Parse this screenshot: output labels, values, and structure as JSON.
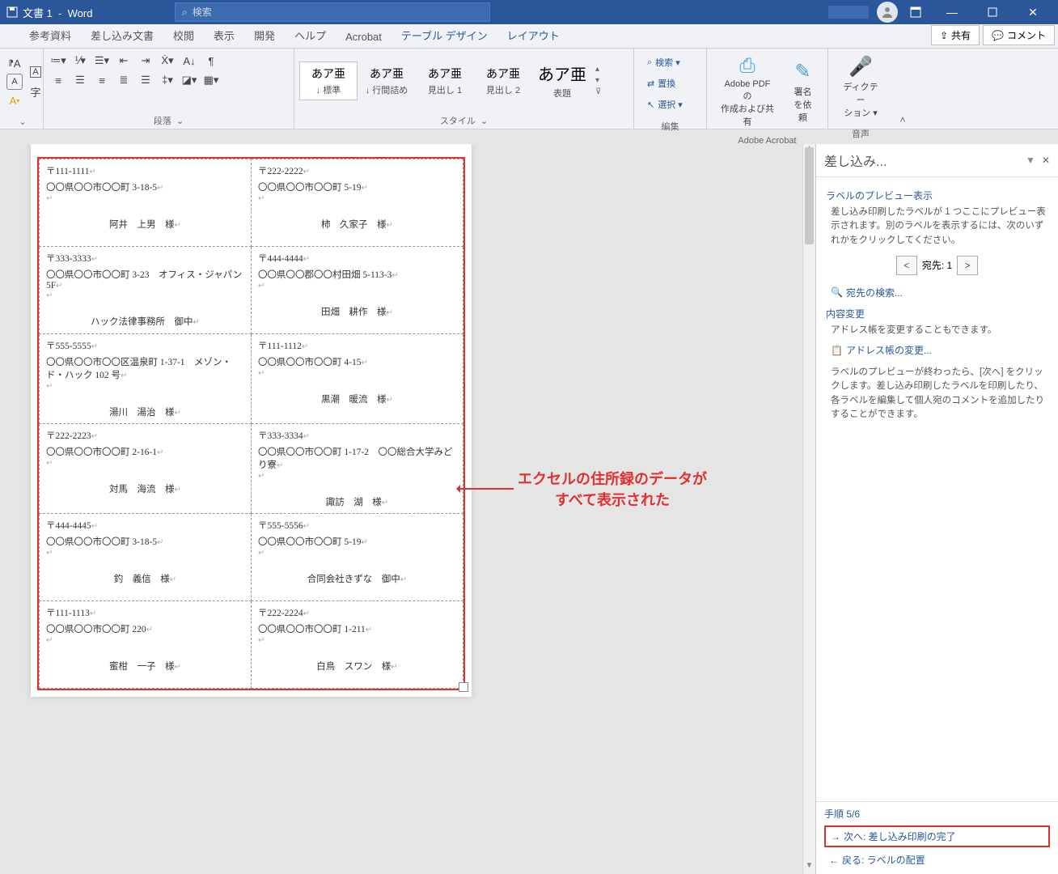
{
  "titlebar": {
    "document": "文書 1",
    "app": "Word",
    "search_placeholder": "検索"
  },
  "tabs": {
    "ref": "参考資料",
    "mailings": "差し込み文書",
    "review": "校閲",
    "view": "表示",
    "dev": "開発",
    "help": "ヘルプ",
    "acrobat": "Acrobat",
    "table_design": "テーブル デザイン",
    "layout": "レイアウト",
    "share": "共有",
    "comment": "コメント"
  },
  "ribbon": {
    "paragraph_label": "段落",
    "styles": [
      {
        "preview": "あア亜",
        "name": "↓ 標準"
      },
      {
        "preview": "あア亜",
        "name": "↓ 行間詰め"
      },
      {
        "preview": "あア亜",
        "name": "見出し 1"
      },
      {
        "preview": "あア亜",
        "name": "見出し 2"
      },
      {
        "preview": "あア亜",
        "name": "表題"
      }
    ],
    "styles_last_big": true,
    "styles_label": "スタイル",
    "edit": {
      "find": "検索 ▾",
      "replace": "置換",
      "select": "選択 ▾",
      "label": "編集"
    },
    "acrobat": {
      "pdf1": "Adobe PDF の",
      "pdf2": "作成および共有",
      "sign1": "署名",
      "sign2": "を依頼",
      "label": "Adobe Acrobat"
    },
    "voice": {
      "dictate1": "ディクテー",
      "dictate2": "ション ▾",
      "label": "音声"
    }
  },
  "labels": [
    [
      {
        "postal": "〒111-1111",
        "addr": "〇〇県〇〇市〇〇町 3-18-5",
        "addr2": "",
        "name": "阿井　上男　様"
      },
      {
        "postal": "〒222-2222",
        "addr": "〇〇県〇〇市〇〇町 5-19",
        "addr2": "",
        "name": "柿　久家子　様"
      }
    ],
    [
      {
        "postal": "〒333-3333",
        "addr": "〇〇県〇〇市〇〇町 3-23　オフィス・ジャパン5F",
        "addr2": "",
        "name": "ハック法律事務所　御中"
      },
      {
        "postal": "〒444-4444",
        "addr": "〇〇県〇〇郡〇〇村田畑 5-113-3",
        "addr2": "",
        "name": "田畑　耕作　様"
      }
    ],
    [
      {
        "postal": "〒555-5555",
        "addr": "〇〇県〇〇市〇〇区温泉町 1-37-1　メゾン・ド・ハック 102 号",
        "addr2": "",
        "name": "湯川　湯治　様"
      },
      {
        "postal": "〒111-1112",
        "addr": "〇〇県〇〇市〇〇町 4-15",
        "addr2": "",
        "name": "黒潮　暖流　様"
      }
    ],
    [
      {
        "postal": "〒222-2223",
        "addr": "〇〇県〇〇市〇〇町 2-16-1",
        "addr2": "",
        "name": "対馬　海流　様"
      },
      {
        "postal": "〒333-3334",
        "addr": "〇〇県〇〇市〇〇町 1-17-2　〇〇総合大学みどり寮",
        "addr2": "",
        "name": "諏訪　湖　様"
      }
    ],
    [
      {
        "postal": "〒444-4445",
        "addr": "〇〇県〇〇市〇〇町 3-18-5",
        "addr2": "",
        "name": "釣　義信　様"
      },
      {
        "postal": "〒555-5556",
        "addr": "〇〇県〇〇市〇〇町 5-19",
        "addr2": "",
        "name": "合同会社きずな　御中"
      }
    ],
    [
      {
        "postal": "〒111-1113",
        "addr": "〇〇県〇〇市〇〇町 220",
        "addr2": "",
        "name": "蜜柑　一子　様"
      },
      {
        "postal": "〒222-2224",
        "addr": "〇〇県〇〇市〇〇町 1-211",
        "addr2": "",
        "name": "白鳥　スワン　様"
      }
    ]
  ],
  "annotation": {
    "line1": "エクセルの住所録のデータが",
    "line2": "すべて表示された"
  },
  "pane": {
    "title": "差し込み...",
    "preview_heading": "ラベルのプレビュー表示",
    "preview_text": "差し込み印刷したラベルが 1 つここにプレビュー表示されます。別のラベルを表示するには、次のいずれかをクリックしてください。",
    "recipient_label": "宛先:",
    "recipient_num": "1",
    "find_recipient": "宛先の検索...",
    "change_heading": "内容変更",
    "change_text": "アドレス帳を変更することもできます。",
    "change_link": "アドレス帳の変更...",
    "finish_text": "ラベルのプレビューが終わったら、[次へ] をクリックします。差し込み印刷したラベルを印刷したり、各ラベルを編集して個人宛のコメントを追加したりすることができます。",
    "step": "手順 5/6",
    "next": "次へ: 差し込み印刷の完了",
    "back": "戻る: ラベルの配置"
  }
}
